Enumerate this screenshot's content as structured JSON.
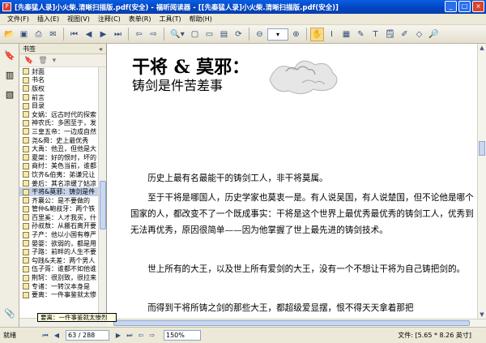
{
  "window": {
    "title": "[先秦猛人录]小火柴.清晰扫描版.pdf(安全) - 福昕阅读器 - [[先秦猛人录]小火柴.清晰扫描版.pdf(安全)]",
    "app_icon": "pdf-icon",
    "minimize": "_",
    "maximize": "□",
    "close": "×"
  },
  "menu": [
    "文件(F)",
    "插入(E)",
    "视图(V)",
    "注释(C)",
    "表单(R)",
    "工具(T)",
    "帮助(H)"
  ],
  "toolbar": {
    "zoom_value": "",
    "hand_tool": "hand-icon",
    "select_tool": "text-select-icon"
  },
  "panel": {
    "title": "书签",
    "close": "«",
    "tools": [
      "bookmark-icon",
      "delete-icon",
      "expand-icon"
    ]
  },
  "bookmarks": [
    "封面",
    "书名",
    "版权",
    "前言",
    "目录",
    "女娲：远古时代的探索",
    "神农氏：多困至于，发",
    "三皇五帝：一边成自然",
    "尧&舜：史上最优秀",
    "大禹：他丑，但他是大",
    "夏桀：好的恨时，坏的",
    "商纣：美色当前，谁都",
    "饮齐&伯夷：弟谦兄让",
    "姜后：其名凉缓了姑凉",
    "干将&莫邪：铸剑是件",
    "齐襄公：是不要做的",
    "管仲&鲍叔牙：两个铁",
    "百里奚：人才我买，什",
    "孙叔敖：从搬石离开要",
    "子产：他以小国有尊严",
    "晏婴：欲弱的，都是用",
    "子路：前畔的人生不要",
    "勾践&夫差：两个男人",
    "伍子胥：谁都不如他谁",
    "荆轲：很别致，很拉来",
    "专诸：一转汉本身是",
    "要离：一件事鉴就太惨"
  ],
  "selected_bookmark": 14,
  "tooltip": "要离：一件事鉴就太惨烈",
  "document": {
    "title_main": "干将 & 莫邪：",
    "title_sub": "铸剑是件苦差事",
    "paragraphs": [
      "历史上最有名最能干的铸剑工人，非干将莫属。",
      "至于干将是哪国人，历史学家也莫衷一是。有人说吴国，有人说楚国，但不论他是哪个国家的人，都改变不了一个既成事实：干将是这个世界上最优秀最优秀的铸剑工人，优秀到无法再优秀，原因很简单——因为他掌握了世上最先进的铸剑技术。",
      "世上所有的大王，以及世上所有爱剑的大王，没有一个不想让干将为自己铸把剑的。",
      "而得到干将所铸之剑的那些大王，都超级爱显摆，恨不得天天拿着那把"
    ]
  },
  "status": {
    "ready": "就绪",
    "page_current": "63",
    "page_sep": "/",
    "page_total": "288",
    "zoom": "150%",
    "file_size": "文件: [5.65 * 8.26 英寸]"
  }
}
